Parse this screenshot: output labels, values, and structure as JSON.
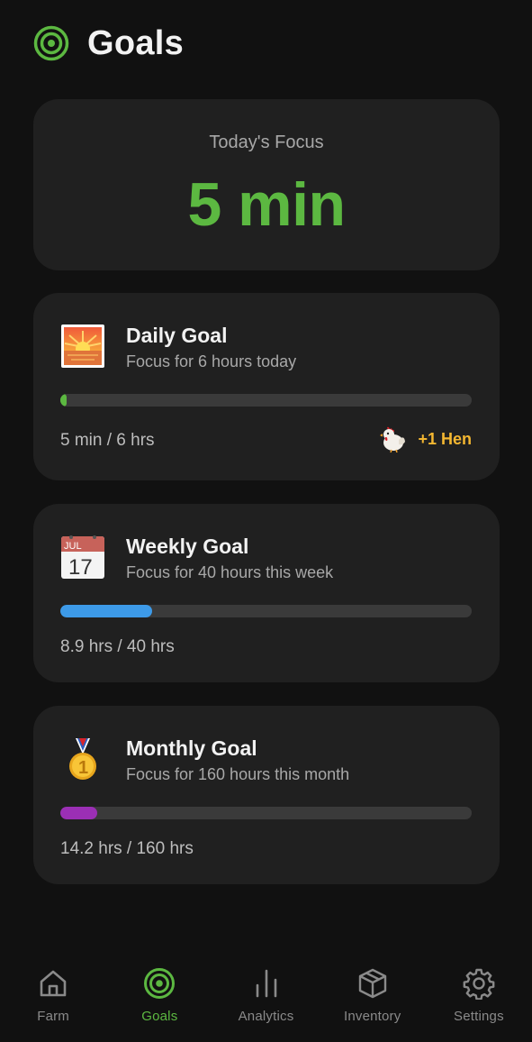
{
  "header": {
    "title": "Goals",
    "icon": "target-icon"
  },
  "focus": {
    "label": "Today's Focus",
    "value": "5 min"
  },
  "goals": [
    {
      "icon": "sunrise-icon",
      "title": "Daily Goal",
      "subtitle": "Focus for 6 hours today",
      "progress_text": "5 min / 6 hrs",
      "progress_fraction": 0.014,
      "color": "#5cb841",
      "reward": {
        "icon": "hen-icon",
        "label": "+1 Hen",
        "color": "#f4b731"
      }
    },
    {
      "icon": "calendar-icon",
      "title": "Weekly Goal",
      "subtitle": "Focus for 40 hours this week",
      "progress_text": "8.9 hrs / 40 hrs",
      "progress_fraction": 0.2225,
      "color": "#3d9ae8",
      "calendar": {
        "month": "JUL",
        "day": "17"
      }
    },
    {
      "icon": "medal-icon",
      "title": "Monthly Goal",
      "subtitle": "Focus for 160 hours this month",
      "progress_text": "14.2 hrs / 160 hrs",
      "progress_fraction": 0.089,
      "color": "#9b2fb5",
      "medal_number": "1"
    }
  ],
  "tabs": [
    {
      "label": "Farm",
      "icon": "home-icon",
      "active": false
    },
    {
      "label": "Goals",
      "icon": "target-icon",
      "active": true
    },
    {
      "label": "Analytics",
      "icon": "bar-chart-icon",
      "active": false
    },
    {
      "label": "Inventory",
      "icon": "box-icon",
      "active": false
    },
    {
      "label": "Settings",
      "icon": "gear-icon",
      "active": false
    }
  ],
  "colors": {
    "accent": "#5cb841",
    "background": "#111111",
    "card": "#202020"
  }
}
